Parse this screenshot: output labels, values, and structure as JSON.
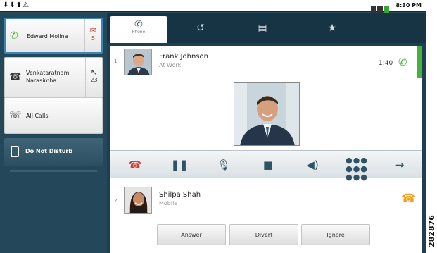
{
  "statusbar": {
    "left_icons": "⬇⬇⬆⚠",
    "time": "8:30 PM"
  },
  "sidebar": {
    "items": [
      {
        "name": "Edward Molina",
        "badge_count": "5"
      },
      {
        "name_line1": "Venkataratnam",
        "name_line2": "Narasimha",
        "badge_count": "23"
      },
      {
        "name": "All Calls"
      },
      {
        "name": "Do Not Disturb"
      }
    ]
  },
  "tabs": [
    {
      "label": "Phone",
      "icon": "phone-icon"
    },
    {
      "label": "",
      "icon": "recents-icon"
    },
    {
      "label": "",
      "icon": "contacts-icon"
    },
    {
      "label": "",
      "icon": "favorites-star-icon"
    }
  ],
  "active_call": {
    "index": "1",
    "name": "Frank Johnson",
    "status": "At Work",
    "duration": "1:40"
  },
  "controls": [
    "end-call-icon",
    "hold-icon",
    "mute-icon",
    "video-off-icon",
    "speaker-icon",
    "keypad-icon",
    "transfer-icon"
  ],
  "incoming_call": {
    "index": "2",
    "name": "Shilpa Shah",
    "status": "Mobile",
    "buttons": {
      "answer": "Answer",
      "divert": "Divert",
      "ignore": "Ignore"
    }
  },
  "watermark": "282876",
  "colors": {
    "accent_green": "#4ab03c",
    "end_call_red": "#d83a2b",
    "incoming_orange": "#f0a020",
    "sidebar_bg": "#24475a"
  }
}
